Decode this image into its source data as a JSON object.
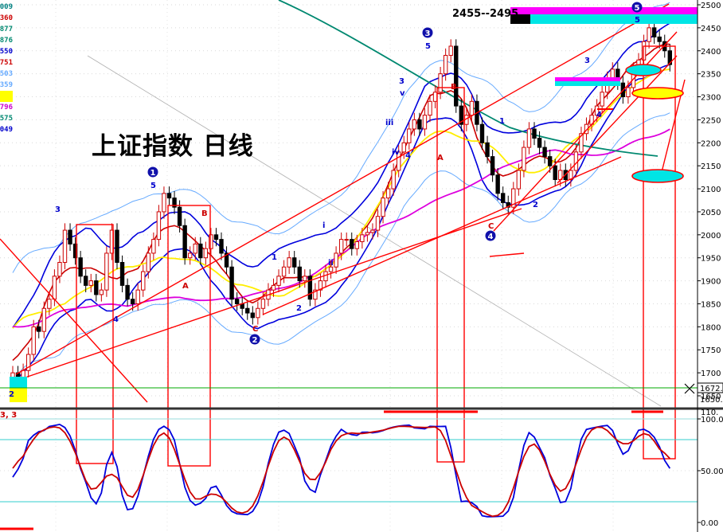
{
  "chart_data": {
    "type": "candlestick",
    "title": "上证指数  日线",
    "range_label": "2455--2495",
    "price_axis": {
      "ticks": [
        "2500",
        "2450",
        "2400",
        "2350",
        "2300",
        "2250",
        "2200",
        "2150",
        "2100",
        "2050",
        "2000",
        "1950",
        "1900",
        "1850",
        "1800",
        "1750",
        "1700",
        "1650"
      ],
      "current_labels": [
        "1672.",
        "1650."
      ]
    },
    "oscillator_axis": {
      "ticks": [
        "100.00",
        "50.00",
        "0.00"
      ],
      "top_label": "110.",
      "header": "3, 3"
    },
    "legend_values": [
      "009",
      "360",
      "877",
      "876",
      "550",
      "751",
      "503",
      "359",
      "",
      "796",
      "575",
      "049"
    ],
    "wave_labels": [
      {
        "text": "2",
        "color": "#0000cc",
        "circled": false
      },
      {
        "text": "3",
        "color": "#0000cc",
        "circled": false
      },
      {
        "text": "4",
        "color": "#0000cc",
        "circled": false
      },
      {
        "text": "1",
        "color": "#0000cc",
        "circled": true
      },
      {
        "text": "5",
        "color": "#0000cc",
        "circled": false
      },
      {
        "text": "A",
        "color": "#cc0000",
        "circled": false
      },
      {
        "text": "B",
        "color": "#cc0000",
        "circled": false
      },
      {
        "text": "C",
        "color": "#cc0000",
        "circled": false
      },
      {
        "text": "2",
        "color": "#0000cc",
        "circled": true
      },
      {
        "text": "1",
        "color": "#0000cc",
        "circled": false
      },
      {
        "text": "2",
        "color": "#0000cc",
        "circled": false
      },
      {
        "text": "i",
        "color": "#0000cc",
        "circled": false
      },
      {
        "text": "ii",
        "color": "#0000cc",
        "circled": false
      },
      {
        "text": "iii",
        "color": "#0000cc",
        "circled": false
      },
      {
        "text": "iv",
        "color": "#0000cc",
        "circled": false
      },
      {
        "text": "v",
        "color": "#0000cc",
        "circled": false
      },
      {
        "text": "3",
        "color": "#0000cc",
        "circled": false
      },
      {
        "text": "4",
        "color": "#0000cc",
        "circled": false
      },
      {
        "text": "5",
        "color": "#0000cc",
        "circled": false
      },
      {
        "text": "3",
        "color": "#0000cc",
        "circled": true
      },
      {
        "text": "A",
        "color": "#cc0000",
        "circled": false
      },
      {
        "text": "B",
        "color": "#cc0000",
        "circled": false
      },
      {
        "text": "C",
        "color": "#cc0000",
        "circled": false
      },
      {
        "text": "4",
        "color": "#0000cc",
        "circled": true
      },
      {
        "text": "1",
        "color": "#0000cc",
        "circled": false
      },
      {
        "text": "2",
        "color": "#0000cc",
        "circled": false
      },
      {
        "text": "3",
        "color": "#0000cc",
        "circled": false
      },
      {
        "text": "4",
        "color": "#0000cc",
        "circled": false
      },
      {
        "text": "5",
        "color": "#0000cc",
        "circled": true
      },
      {
        "text": "5",
        "color": "#0000cc",
        "circled": false
      }
    ],
    "close_series": [
      1700,
      1690,
      1705,
      1740,
      1800,
      1790,
      1840,
      1860,
      1910,
      1940,
      2010,
      1980,
      1950,
      1910,
      1890,
      1900,
      1870,
      1880,
      1960,
      2010,
      1940,
      1890,
      1860,
      1850,
      1880,
      1920,
      1960,
      1990,
      2050,
      2090,
      2080,
      2060,
      2020,
      1950,
      1960,
      1980,
      1950,
      1970,
      2000,
      1990,
      1960,
      1930,
      1860,
      1850,
      1840,
      1830,
      1820,
      1840,
      1860,
      1880,
      1890,
      1910,
      1930,
      1950,
      1930,
      1900,
      1910,
      1860,
      1880,
      1900,
      1920,
      1930,
      1960,
      1990,
      1990,
      1970,
      1985,
      2000,
      2005,
      2010,
      2040,
      2080,
      2100,
      2140,
      2180,
      2200,
      2230,
      2250,
      2230,
      2260,
      2290,
      2310,
      2350,
      2390,
      2410,
      2280,
      2240,
      2260,
      2290,
      2240,
      2200,
      2170,
      2130,
      2090,
      2070,
      2060,
      2100,
      2140,
      2190,
      2230,
      2210,
      2190,
      2170,
      2150,
      2120,
      2140,
      2120,
      2140,
      2180,
      2220,
      2240,
      2260,
      2280,
      2310,
      2340,
      2360,
      2330,
      2300,
      2320,
      2360,
      2380,
      2420,
      2450,
      2430,
      2420,
      2400,
      2370
    ]
  },
  "colors": {
    "up": "#cc0000",
    "down": "#000000",
    "ma_fast": "#ffee00",
    "ma_mid": "#dd00dd",
    "ma_slow": "#008870",
    "band_inner": "#0000dd",
    "band_outer": "#66aaff",
    "k_line": "#0000dd",
    "d_line": "#cc0000",
    "annotation": "#ff0000"
  }
}
